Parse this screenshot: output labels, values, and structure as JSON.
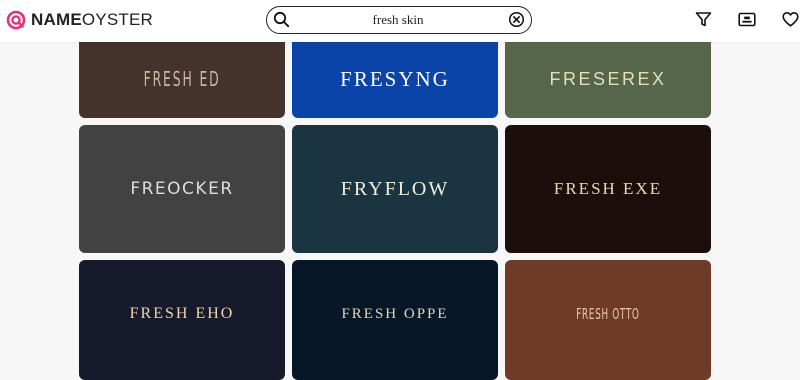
{
  "brand": {
    "bold": "NAME",
    "light": "OYSTER",
    "accent": "#e8317a"
  },
  "search": {
    "value": "fresh skin"
  },
  "header_icons": [
    "filter-icon",
    "id-card-icon",
    "heart-icon"
  ],
  "cards": [
    {
      "name": "FRESH ED",
      "bg": "#45322a",
      "color": "#c9b7a6"
    },
    {
      "name": "FRESYNG",
      "bg": "#0a44a8",
      "color": "#ffffff"
    },
    {
      "name": "FRESEREX",
      "bg": "#56664a",
      "color": "#e6dfb4"
    },
    {
      "name": "FREOCKER",
      "bg": "#424242",
      "color": "#dcdcdc"
    },
    {
      "name": "FRYFLOW",
      "bg": "#1b3441",
      "color": "#f3ecd8"
    },
    {
      "name": "FRESH EXE",
      "bg": "#1c0f0b",
      "color": "#ead9b0"
    },
    {
      "name": "FRESH EHO",
      "bg": "#161a2a",
      "color": "#efd6a9"
    },
    {
      "name": "FRESH OPPE",
      "bg": "#061727",
      "color": "#e8d4b6"
    },
    {
      "name": "FRESH OTTO",
      "bg": "#6f3a28",
      "color": "#e8c8a8"
    }
  ]
}
